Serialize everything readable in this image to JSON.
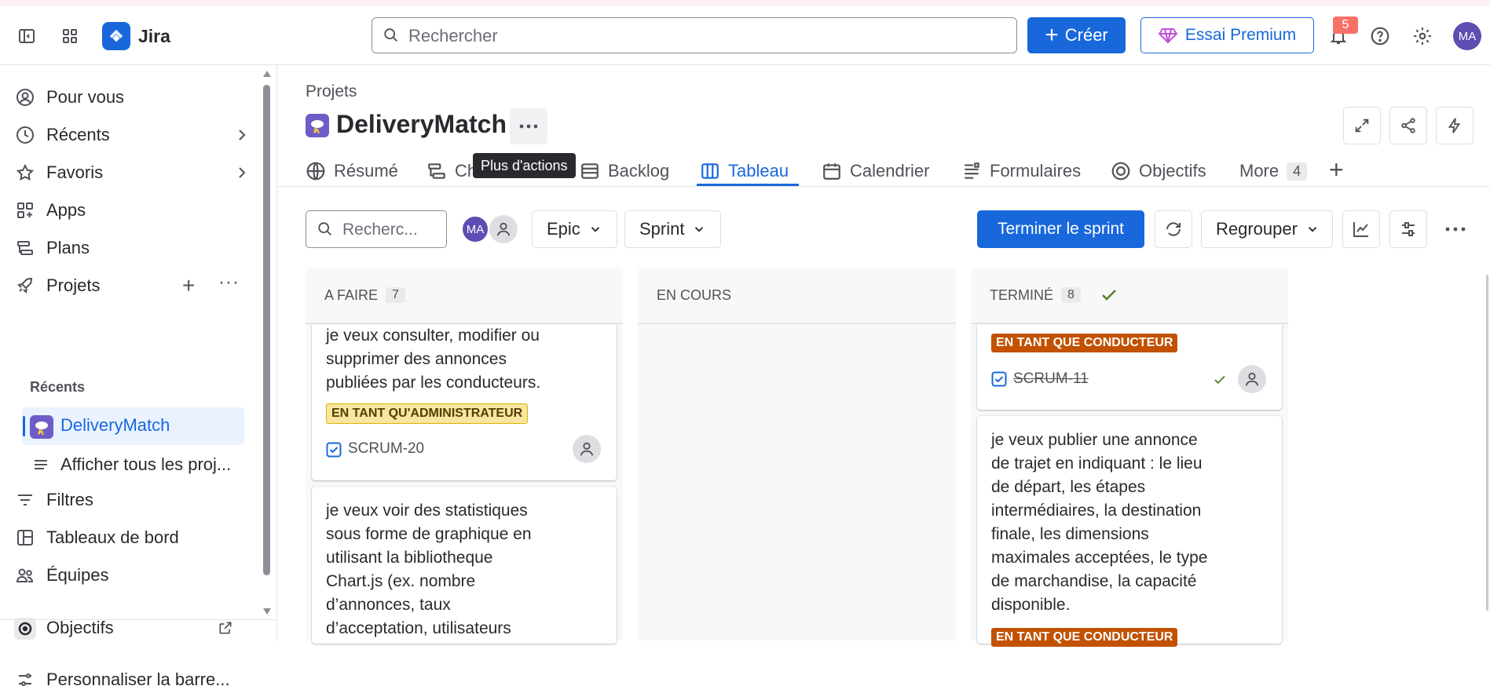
{
  "app": {
    "name": "Jira"
  },
  "topbar": {
    "search_placeholder": "Rechercher",
    "create_label": "Créer",
    "premium_label": "Essai Premium",
    "notification_count": "5",
    "user_initials": "MA"
  },
  "sidebar": {
    "items": [
      {
        "label": "Pour vous",
        "icon": "user-circle-icon"
      },
      {
        "label": "Récents",
        "icon": "clock-icon"
      },
      {
        "label": "Favoris",
        "icon": "star-icon"
      },
      {
        "label": "Apps",
        "icon": "apps-icon"
      },
      {
        "label": "Plans",
        "icon": "plans-icon"
      },
      {
        "label": "Projets",
        "icon": "rocket-icon"
      }
    ],
    "recent_heading": "Récents",
    "selected_project": "DeliveryMatch",
    "show_all_projects": "Afficher tous les proj...",
    "filters": "Filtres",
    "dashboards": "Tableaux de bord",
    "teams": "Équipes",
    "goals": "Objectifs",
    "customize": "Personnaliser la barre..."
  },
  "header": {
    "breadcrumb": "Projets",
    "project_name": "DeliveryMatch",
    "tooltip": "Plus d'actions"
  },
  "tabs": {
    "summary": "Résumé",
    "chronology": "Ch",
    "backlog": "Backlog",
    "board": "Tableau",
    "calendar": "Calendrier",
    "forms": "Formulaires",
    "goals": "Objectifs",
    "more": "More",
    "more_count": "4"
  },
  "toolbar": {
    "search_placeholder": "Recherc...",
    "avatar_initials": "MA",
    "epic_label": "Epic",
    "sprint_label": "Sprint",
    "complete_sprint": "Terminer le sprint",
    "group_label": "Regrouper"
  },
  "columns": {
    "todo": {
      "title": "A FAIRE",
      "count": "7",
      "cards": [
        {
          "lines": [
            "je veux consulter, modifier ou",
            "supprimer des annonces",
            "publiées par les conducteurs."
          ],
          "label": "EN TANT QU'ADMINISTRATEUR",
          "key": "SCRUM-20"
        },
        {
          "lines": [
            "je veux voir des statistiques",
            "sous forme de graphique en",
            "utilisant la bibliotheque",
            "Chart.js (ex. nombre",
            "d’annonces, taux",
            "d’acceptation, utilisateurs"
          ]
        }
      ]
    },
    "in_progress": {
      "title": "EN COURS"
    },
    "done": {
      "title": "TERMINÉ",
      "count": "8",
      "cards": [
        {
          "label": "EN TANT QUE CONDUCTEUR",
          "key": "SCRUM-11"
        },
        {
          "lines": [
            "je veux publier une annonce",
            "de trajet en indiquant : le lieu",
            "de départ, les étapes",
            "intermédiaires, la destination",
            "finale, les dimensions",
            "maximales acceptées, le type",
            "de marchandise, la capacité",
            "disponible."
          ],
          "label": "EN TANT QUE CONDUCTEUR"
        }
      ]
    }
  },
  "colors": {
    "accent": "#1868DB",
    "avatar": "#5E4DB2",
    "label_admin_bg": "#F8E6A0",
    "label_driver_bg": "#C25100",
    "notification": "#F87168"
  }
}
